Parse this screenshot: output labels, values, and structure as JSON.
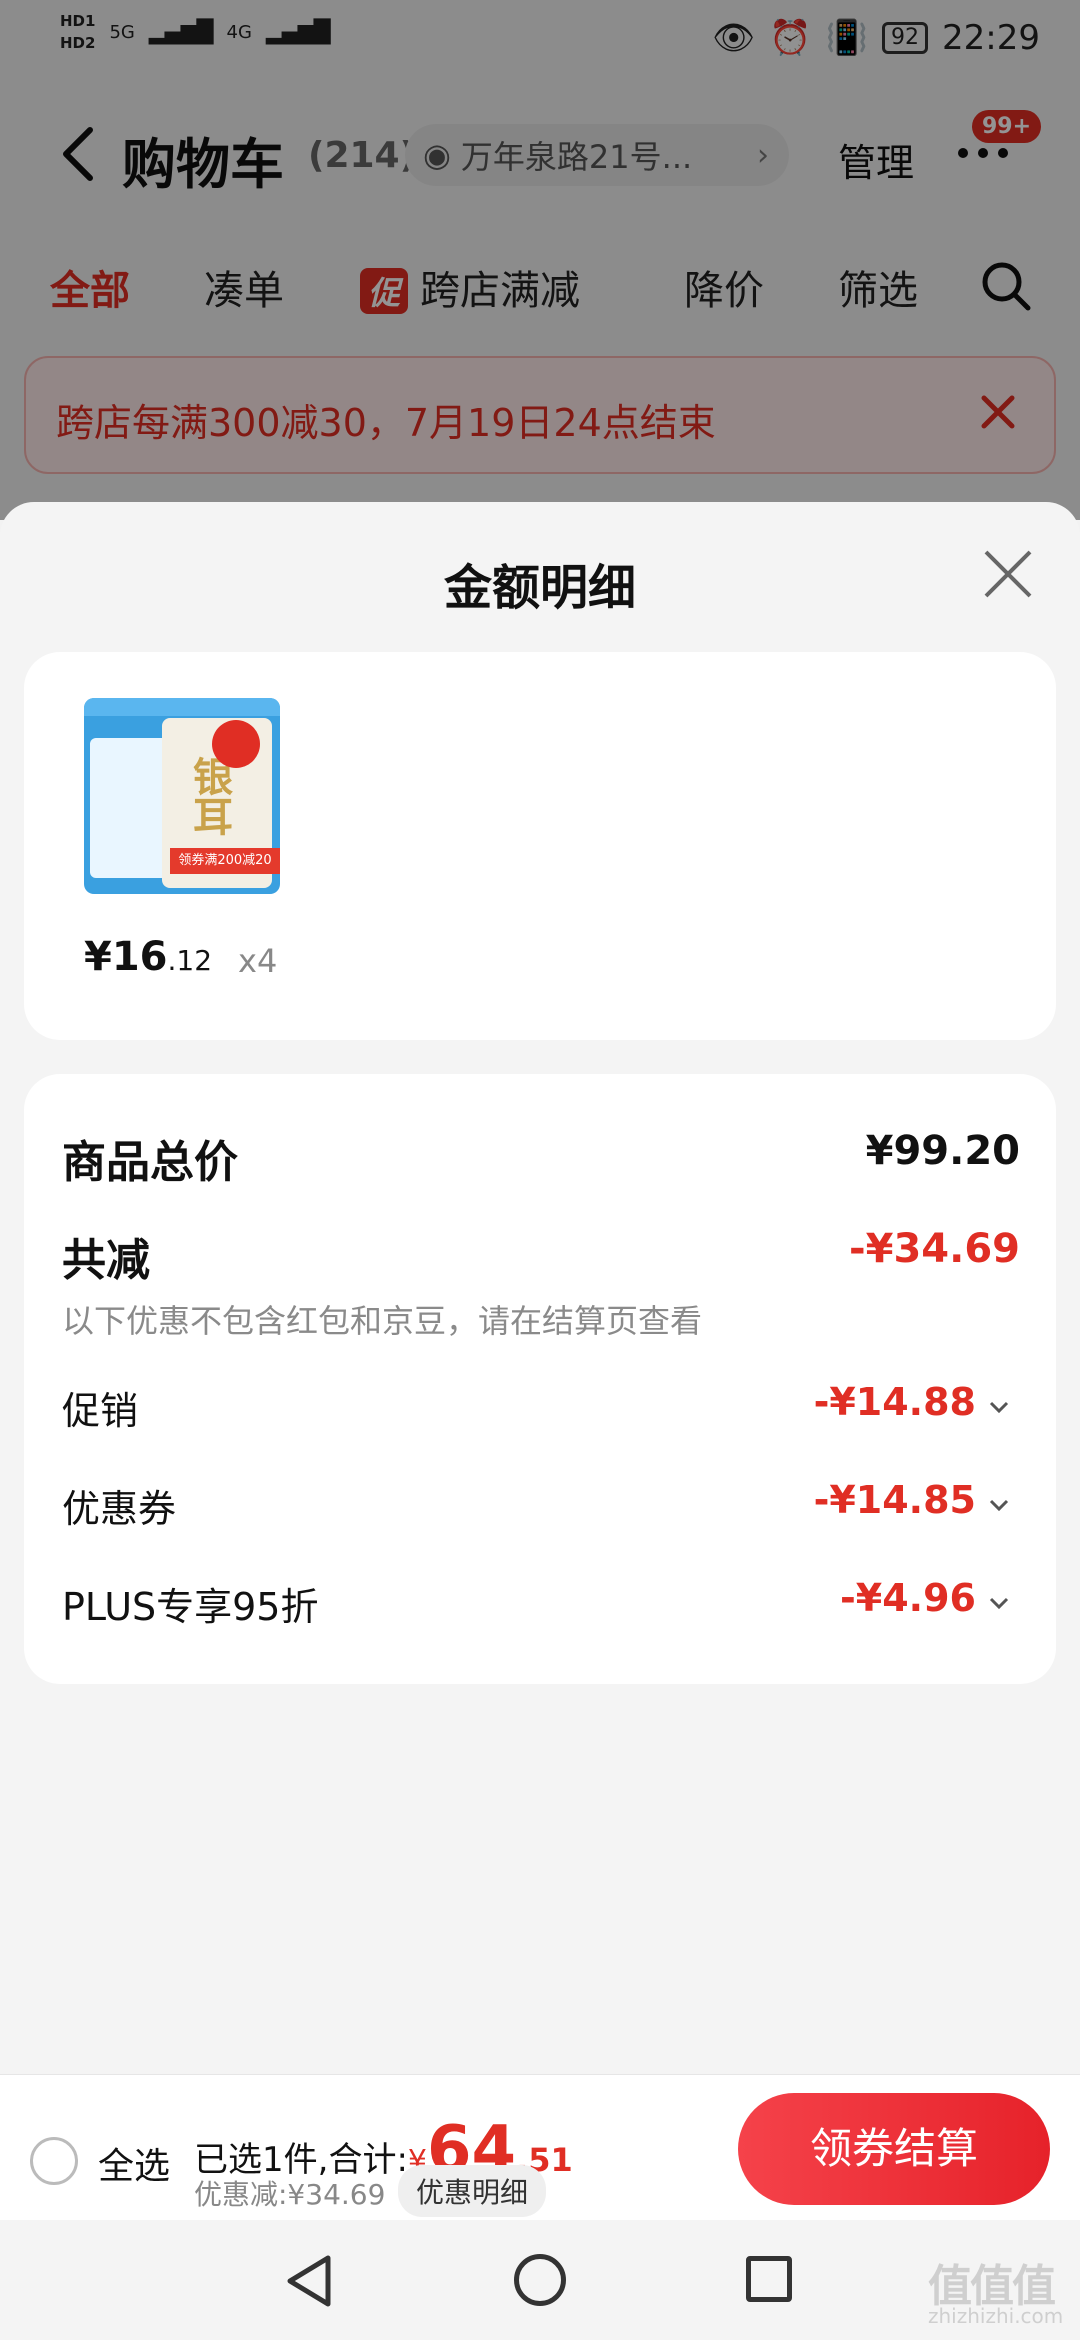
{
  "status_bar": {
    "hd1": "HD1",
    "hd2": "HD2",
    "net1": "5G",
    "net2": "4G",
    "battery": "92",
    "time": "22:29"
  },
  "header": {
    "title": "购物车",
    "count": "(214)",
    "address": "万年泉路21号...",
    "manage": "管理",
    "notif_badge": "99+"
  },
  "tabs": [
    {
      "label": "全部",
      "active": true
    },
    {
      "label": "凑单"
    },
    {
      "label": "跨店满减",
      "mark": "促"
    },
    {
      "label": "降价"
    },
    {
      "label": "筛选"
    }
  ],
  "banner": {
    "text": "跨店每满300减30，7月19日24点结束"
  },
  "sheet": {
    "title": "金额明细",
    "product": {
      "image_text": "银耳",
      "ribbon": "领券满200减20",
      "price_main": "¥16",
      "price_cents": ".12",
      "qty": "x4"
    },
    "summary": {
      "total_label": "商品总价",
      "total_value": "¥99.20",
      "reduce_label": "共减",
      "reduce_value": "-¥34.69",
      "note": "以下优惠不包含红包和京豆，请在结算页查看",
      "items": [
        {
          "label": "促销",
          "value": "-¥14.88"
        },
        {
          "label": "优惠券",
          "value": "-¥14.85"
        },
        {
          "label": "PLUS专享95折",
          "value": "-¥4.96"
        }
      ]
    }
  },
  "bottom_bar": {
    "select_all": "全选",
    "summary_prefix": "已选1件,合计:",
    "yen": "¥",
    "total_int": "64",
    "total_dec": ".51",
    "discount": "优惠减:¥34.69",
    "detail_chip": "优惠明细",
    "checkout": "领券结算"
  },
  "watermark": {
    "text": "值值值",
    "domain": "zhizhizhi.com"
  },
  "colors": {
    "accent_red": "#e02e24",
    "sheet_bg": "#f4f4f4"
  }
}
